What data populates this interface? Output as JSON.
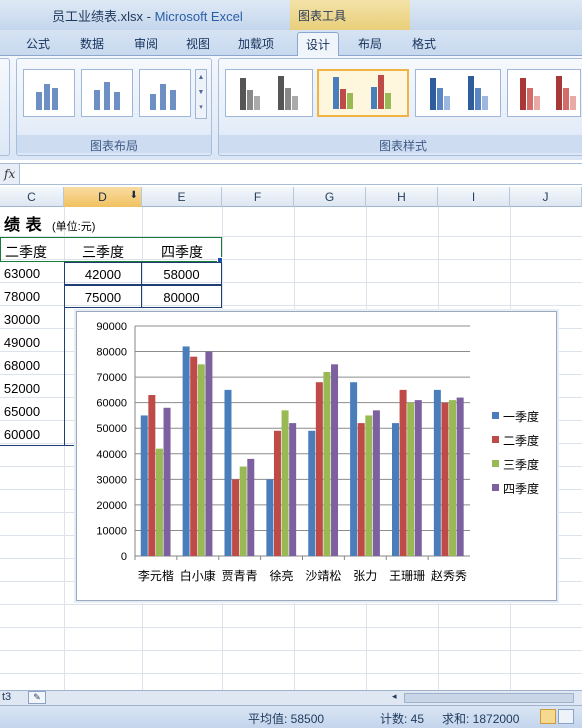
{
  "window": {
    "title_file": "员工业绩表.xlsx",
    "title_sep": " - ",
    "title_app": "Microsoft Excel",
    "context_tool": "图表工具"
  },
  "ribbon_tabs": [
    "公式",
    "数据",
    "审阅",
    "视图",
    "加载项",
    "设计",
    "布局",
    "格式"
  ],
  "active_tab": "设计",
  "ribbon_groups": {
    "layout_label": "图表布局",
    "style_label": "图表样式"
  },
  "formula_bar": {
    "fx": "fx",
    "value": ""
  },
  "columns": [
    "C",
    "D",
    "E",
    "F",
    "G",
    "H",
    "I",
    "J"
  ],
  "selected_column": "D",
  "sheet": {
    "title": "绩 表",
    "unit": "(单位:元)",
    "headers": [
      "二季度",
      "三季度",
      "四季度"
    ],
    "rows": [
      [
        "63000",
        "42000",
        "58000"
      ],
      [
        "78000",
        "75000",
        "80000"
      ],
      [
        "30000",
        "",
        ""
      ],
      [
        "49000",
        "",
        ""
      ],
      [
        "68000",
        "",
        ""
      ],
      [
        "52000",
        "",
        ""
      ],
      [
        "65000",
        "",
        ""
      ],
      [
        "60000",
        "",
        ""
      ]
    ]
  },
  "chart_data": {
    "type": "bar",
    "categories": [
      "李元楷",
      "白小康",
      "贾青青",
      "徐亮",
      "沙靖松",
      "张力",
      "王珊珊",
      "赵秀秀"
    ],
    "series": [
      {
        "name": "一季度",
        "color": "#4a7ebb",
        "values": [
          55000,
          82000,
          65000,
          30000,
          49000,
          68000,
          52000,
          65000
        ]
      },
      {
        "name": "二季度",
        "color": "#be4b48",
        "values": [
          63000,
          78000,
          30000,
          49000,
          68000,
          52000,
          65000,
          60000
        ]
      },
      {
        "name": "三季度",
        "color": "#98b954",
        "values": [
          42000,
          75000,
          35000,
          57000,
          72000,
          55000,
          60000,
          61000
        ]
      },
      {
        "name": "四季度",
        "color": "#7d60a0",
        "values": [
          58000,
          80000,
          38000,
          52000,
          75000,
          57000,
          61000,
          62000
        ]
      }
    ],
    "ylim": [
      0,
      90000
    ],
    "yticks": [
      "0",
      "10000",
      "20000",
      "30000",
      "40000",
      "50000",
      "60000",
      "70000",
      "80000",
      "90000"
    ],
    "grid": true,
    "legend_position": "right"
  },
  "status": {
    "average": "平均值: 58500",
    "count": "计数: 45",
    "sum": "求和: 1872000"
  }
}
